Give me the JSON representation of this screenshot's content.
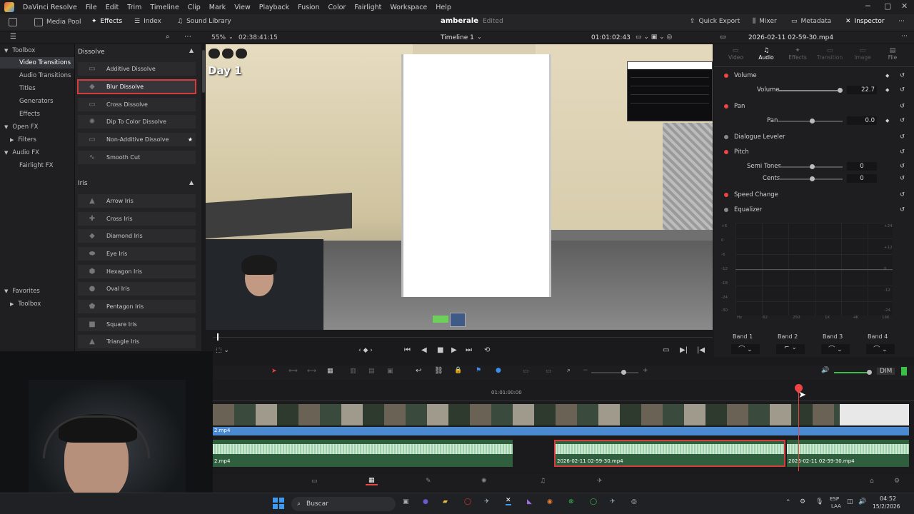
{
  "menubar": {
    "app": "DaVinci Resolve",
    "items": [
      "File",
      "Edit",
      "Trim",
      "Timeline",
      "Clip",
      "Mark",
      "View",
      "Playback",
      "Fusion",
      "Color",
      "Fairlight",
      "Workspace",
      "Help"
    ]
  },
  "toolbar": {
    "media_pool": "Media Pool",
    "effects": "Effects",
    "index": "Index",
    "sound_library": "Sound Library",
    "project": "amberale",
    "project_status": "Edited",
    "quick_export": "Quick Export",
    "mixer": "Mixer",
    "metadata": "Metadata",
    "inspector": "Inspector"
  },
  "subbar": {
    "zoom": "55%",
    "timecode_left": "02:38:41:15",
    "timeline_name": "Timeline 1",
    "timecode_right": "01:01:02:43",
    "clip_name": "2026-02-11 02-59-30.mp4"
  },
  "toolbox_tree": {
    "toolbox": "Toolbox",
    "video_transitions": "Video Transitions",
    "audio_transitions": "Audio Transitions",
    "titles": "Titles",
    "generators": "Generators",
    "effects": "Effects",
    "open_fx": "Open FX",
    "filters": "Filters",
    "audio_fx": "Audio FX",
    "fairlight_fx": "Fairlight FX",
    "favorites": "Favorites",
    "fav_toolbox": "Toolbox"
  },
  "dissolve": {
    "header": "Dissolve",
    "items": [
      "Additive Dissolve",
      "Blur Dissolve",
      "Cross Dissolve",
      "Dip To Color Dissolve",
      "Non-Additive Dissolve",
      "Smooth Cut"
    ]
  },
  "iris": {
    "header": "Iris",
    "items": [
      "Arrow Iris",
      "Cross Iris",
      "Diamond Iris",
      "Eye Iris",
      "Hexagon Iris",
      "Oval Iris",
      "Pentagon Iris",
      "Square Iris",
      "Triangle Iris"
    ]
  },
  "viewer": {
    "overlay_title": "Day 1"
  },
  "inspector": {
    "tabs": [
      "Video",
      "Audio",
      "Effects",
      "Transition",
      "Image",
      "File"
    ],
    "active_tab": "Audio",
    "volume_header": "Volume",
    "volume_label": "Volume",
    "volume_value": "22.7",
    "pan_header": "Pan",
    "pan_label": "Pan",
    "pan_value": "0.0",
    "dialogue_leveler": "Dialogue Leveler",
    "pitch_header": "Pitch",
    "semi_tones_label": "Semi Tones",
    "semi_tones_value": "0",
    "cents_label": "Cents",
    "cents_value": "0",
    "speed_change": "Speed Change",
    "equalizer": "Equalizer",
    "eq_left_ticks": [
      "+6",
      "0",
      "-6",
      "-12",
      "-18",
      "-24",
      "-30"
    ],
    "eq_right_ticks": [
      "+24",
      "+12",
      "0",
      "-12",
      "-24"
    ],
    "eq_freqs": [
      "Hz",
      "62",
      "250",
      "1K",
      "4K",
      "16K"
    ],
    "bands": [
      "Band 1",
      "Band 2",
      "Band 3",
      "Band 4"
    ]
  },
  "timeline": {
    "ruler_time": "01:01:00:00",
    "clip_video": "2.mp4",
    "clip_audio": "2.mp4",
    "clip_audio2": "2026-02-11 02-59-30.mp4",
    "clip_audio3": "2026-02-11 02-59-30.mp4",
    "dim": "DIM"
  },
  "taskbar": {
    "search": "Buscar",
    "lang": "ESP",
    "lang2": "LAA",
    "time": "04:52",
    "date": "15/2/2026"
  }
}
